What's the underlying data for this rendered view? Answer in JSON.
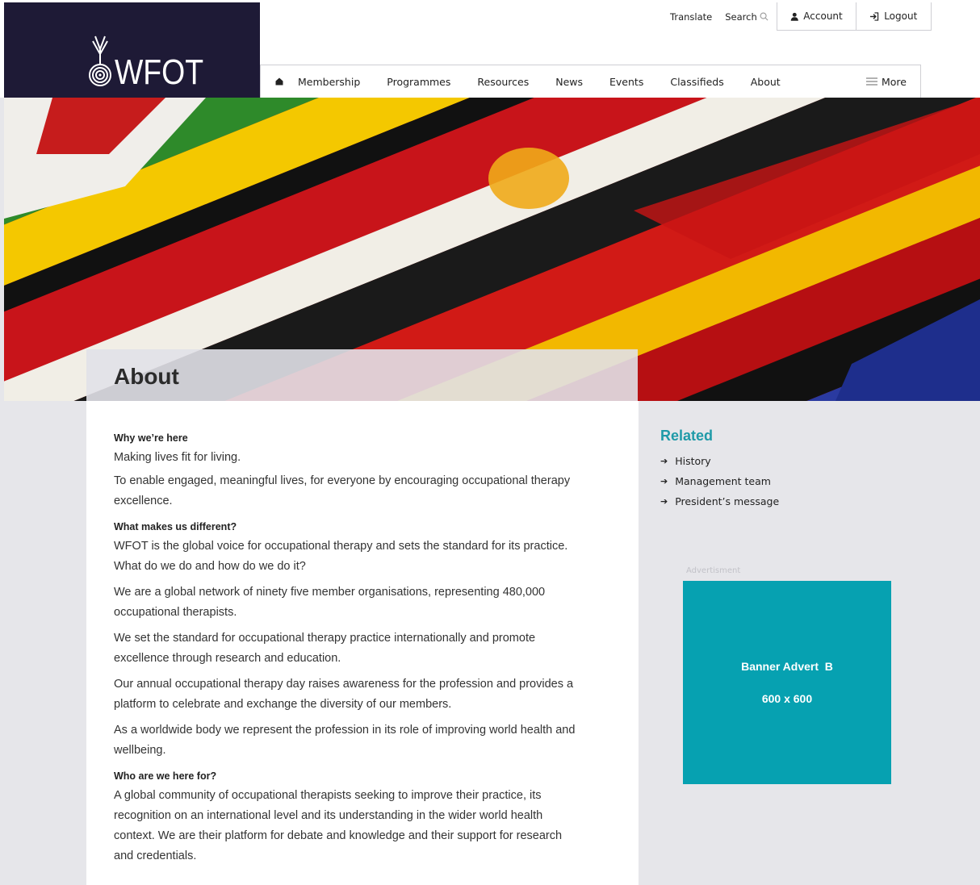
{
  "brand": {
    "name": "WFOT"
  },
  "topbar": {
    "translate": "Translate",
    "search": "Search",
    "account": "Account",
    "logout": "Logout"
  },
  "nav": {
    "items": [
      "Membership",
      "Programmes",
      "Resources",
      "News",
      "Events",
      "Classifieds",
      "About"
    ],
    "more": "More"
  },
  "page": {
    "title": "About"
  },
  "content": {
    "sections": [
      {
        "heading": "Why we’re here",
        "paragraphs": [
          "Making lives fit for living.",
          "To enable engaged, meaningful lives, for everyone by encouraging occupational therapy excellence."
        ]
      },
      {
        "heading": "What makes us different?",
        "paragraphs": [
          "WFOT is the global voice for occupational therapy and sets the standard for its practice. What do we do and how do we do it?",
          "We are a global network of ninety five member organisations, representing 480,000 occupational therapists.",
          "We set the standard for occupational therapy practice internationally and promote excellence through research and education.",
          "Our annual occupational therapy day raises awareness for the profession and provides a platform to celebrate and exchange the diversity of our members.",
          "As a worldwide body we represent the profession in its role of improving world health and wellbeing."
        ]
      },
      {
        "heading": "Who are we here for?",
        "paragraphs": [
          "A global community of occupational therapists seeking to improve their practice, its recognition on an international level and its understanding in the wider world health context. We are their platform for debate and knowledge and their support for research and credentials."
        ]
      }
    ]
  },
  "sidebar": {
    "related_title": "Related",
    "related": [
      "History",
      "Management team",
      "President’s message"
    ]
  },
  "ad": {
    "label": "Advertisment",
    "line1": "Banner Advert  B",
    "line2": "600 x 600"
  },
  "colors": {
    "navy": "#1e1a36",
    "teal": "#06a1b1",
    "accent": "#1f9aa8"
  }
}
